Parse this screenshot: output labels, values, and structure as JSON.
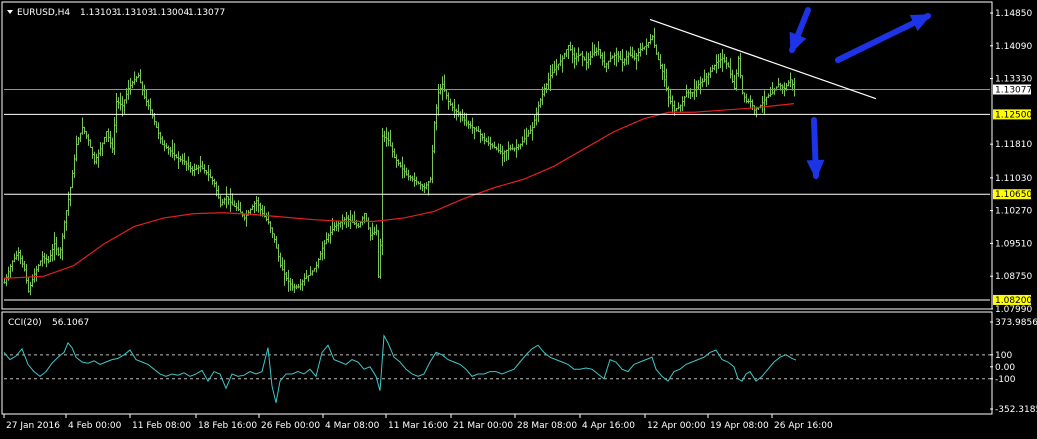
{
  "colors": {
    "background": "#000000",
    "frame": "#ffffff",
    "candles": "#7bc35a",
    "moving_average": "#e02020",
    "cci_line": "#3fc7c7",
    "trendline": "#ffffff",
    "level_line": "#ffffff",
    "level_tag_bg": "#ffff00",
    "current_price_line": "#8a93a8",
    "arrows": "#1c34e6"
  },
  "chart_data": [
    {
      "type": "candlestick",
      "header": {
        "symbol": "EURUSD,H4",
        "open": "1.13103",
        "high": "1.13103",
        "low": "1.13004",
        "close": "1.13077"
      },
      "ylim": [
        1.0799,
        1.1485
      ],
      "y_ticks": [
        "1.14850",
        "1.14090",
        "1.13330",
        "1.12500",
        "1.11810",
        "1.11030",
        "1.10270",
        "1.09510",
        "1.08750",
        "1.07990"
      ],
      "x_ticks": [
        "27 Jan 2016",
        "4 Feb 00:00",
        "11 Feb 08:00",
        "18 Feb 16:00",
        "26 Feb 00:00",
        "4 Mar 08:00",
        "11 Mar 16:00",
        "21 Mar 00:00",
        "28 Mar 08:00",
        "4 Apr 16:00",
        "12 Apr 00:00",
        "19 Apr 08:00",
        "26 Apr 16:00"
      ],
      "current_price": "1.13077",
      "horizontal_levels": [
        {
          "price": 1.125,
          "label": "1.12500"
        },
        {
          "price": 1.1065,
          "label": "1.10650"
        },
        {
          "price": 1.082,
          "label": "1.08200"
        }
      ],
      "close_path": [
        [
          0,
          1.086
        ],
        [
          8,
          1.091
        ],
        [
          14,
          1.093
        ],
        [
          20,
          1.089
        ],
        [
          24,
          1.084
        ],
        [
          30,
          1.088
        ],
        [
          38,
          1.092
        ],
        [
          44,
          1.091
        ],
        [
          50,
          1.095
        ],
        [
          55,
          1.092
        ],
        [
          60,
          1.1
        ],
        [
          66,
          1.108
        ],
        [
          72,
          1.118
        ],
        [
          78,
          1.122
        ],
        [
          84,
          1.119
        ],
        [
          90,
          1.114
        ],
        [
          96,
          1.117
        ],
        [
          102,
          1.121
        ],
        [
          108,
          1.117
        ],
        [
          112,
          1.128
        ],
        [
          118,
          1.127
        ],
        [
          124,
          1.131
        ],
        [
          130,
          1.133
        ],
        [
          134,
          1.134
        ],
        [
          140,
          1.129
        ],
        [
          146,
          1.126
        ],
        [
          152,
          1.122
        ],
        [
          158,
          1.118
        ],
        [
          164,
          1.117
        ],
        [
          172,
          1.115
        ],
        [
          180,
          1.114
        ],
        [
          188,
          1.112
        ],
        [
          196,
          1.113
        ],
        [
          204,
          1.111
        ],
        [
          210,
          1.109
        ],
        [
          216,
          1.104
        ],
        [
          222,
          1.106
        ],
        [
          228,
          1.104
        ],
        [
          234,
          1.103
        ],
        [
          240,
          1.101
        ],
        [
          246,
          1.103
        ],
        [
          252,
          1.105
        ],
        [
          258,
          1.102
        ],
        [
          264,
          1.1
        ],
        [
          270,
          1.096
        ],
        [
          276,
          1.09
        ],
        [
          282,
          1.087
        ],
        [
          288,
          1.085
        ],
        [
          294,
          1.085
        ],
        [
          300,
          1.087
        ],
        [
          306,
          1.088
        ],
        [
          312,
          1.09
        ],
        [
          318,
          1.094
        ],
        [
          324,
          1.097
        ],
        [
          330,
          1.099
        ],
        [
          336,
          1.1
        ],
        [
          342,
          1.101
        ],
        [
          348,
          1.1
        ],
        [
          354,
          1.099
        ],
        [
          360,
          1.102
        ],
        [
          366,
          1.097
        ],
        [
          372,
          1.098
        ],
        [
          375,
          1.082
        ],
        [
          378,
          1.12
        ],
        [
          384,
          1.119
        ],
        [
          390,
          1.115
        ],
        [
          396,
          1.113
        ],
        [
          402,
          1.111
        ],
        [
          408,
          1.11
        ],
        [
          414,
          1.109
        ],
        [
          420,
          1.108
        ],
        [
          426,
          1.11
        ],
        [
          430,
          1.123
        ],
        [
          434,
          1.13
        ],
        [
          438,
          1.132
        ],
        [
          444,
          1.128
        ],
        [
          450,
          1.126
        ],
        [
          456,
          1.125
        ],
        [
          462,
          1.123
        ],
        [
          468,
          1.122
        ],
        [
          474,
          1.121
        ],
        [
          480,
          1.119
        ],
        [
          486,
          1.118
        ],
        [
          492,
          1.117
        ],
        [
          498,
          1.116
        ],
        [
          504,
          1.117
        ],
        [
          510,
          1.117
        ],
        [
          516,
          1.118
        ],
        [
          522,
          1.12
        ],
        [
          528,
          1.122
        ],
        [
          534,
          1.127
        ],
        [
          540,
          1.131
        ],
        [
          546,
          1.134
        ],
        [
          552,
          1.136
        ],
        [
          558,
          1.138
        ],
        [
          564,
          1.141
        ],
        [
          570,
          1.138
        ],
        [
          576,
          1.139
        ],
        [
          582,
          1.137
        ],
        [
          588,
          1.139
        ],
        [
          594,
          1.14
        ],
        [
          600,
          1.136
        ],
        [
          606,
          1.138
        ],
        [
          612,
          1.139
        ],
        [
          618,
          1.137
        ],
        [
          624,
          1.139
        ],
        [
          630,
          1.138
        ],
        [
          636,
          1.14
        ],
        [
          642,
          1.141
        ],
        [
          648,
          1.143
        ],
        [
          652,
          1.139
        ],
        [
          658,
          1.135
        ],
        [
          664,
          1.129
        ],
        [
          670,
          1.126
        ],
        [
          676,
          1.127
        ],
        [
          682,
          1.13
        ],
        [
          688,
          1.13
        ],
        [
          694,
          1.132
        ],
        [
          700,
          1.133
        ],
        [
          706,
          1.135
        ],
        [
          712,
          1.137
        ],
        [
          718,
          1.138
        ],
        [
          724,
          1.136
        ],
        [
          730,
          1.131
        ],
        [
          734,
          1.138
        ],
        [
          738,
          1.13
        ],
        [
          742,
          1.128
        ],
        [
          746,
          1.128
        ],
        [
          750,
          1.126
        ],
        [
          756,
          1.127
        ],
        [
          762,
          1.129
        ],
        [
          768,
          1.13
        ],
        [
          774,
          1.132
        ],
        [
          780,
          1.131
        ],
        [
          786,
          1.133
        ],
        [
          790,
          1.1308
        ]
      ],
      "moving_average": [
        [
          0,
          1.087
        ],
        [
          40,
          1.0875
        ],
        [
          70,
          1.09
        ],
        [
          100,
          1.095
        ],
        [
          130,
          1.099
        ],
        [
          160,
          1.101
        ],
        [
          190,
          1.102
        ],
        [
          220,
          1.1022
        ],
        [
          250,
          1.1018
        ],
        [
          280,
          1.1012
        ],
        [
          310,
          1.1006
        ],
        [
          340,
          1.1002
        ],
        [
          370,
          1.1002
        ],
        [
          400,
          1.101
        ],
        [
          430,
          1.1025
        ],
        [
          460,
          1.1055
        ],
        [
          490,
          1.108
        ],
        [
          520,
          1.11
        ],
        [
          550,
          1.113
        ],
        [
          580,
          1.117
        ],
        [
          610,
          1.121
        ],
        [
          640,
          1.124
        ],
        [
          665,
          1.1255
        ],
        [
          690,
          1.1255
        ],
        [
          720,
          1.126
        ],
        [
          750,
          1.1265
        ],
        [
          770,
          1.127
        ],
        [
          790,
          1.1275
        ]
      ],
      "trendline": [
        {
          "date_at": 0,
          "price": 1.147
        },
        {
          "date_at": 1,
          "price": 1.1305
        }
      ]
    },
    {
      "type": "line",
      "indicator": "CCI(20)",
      "current_value": "56.1067",
      "max_label": "373.9856",
      "min_label": "-352.3185",
      "ylim": [
        -352.3185,
        373.9856
      ],
      "y_ticks": [
        "100",
        "0.00",
        "-100"
      ],
      "levels": [
        100,
        -100
      ],
      "values": [
        [
          0,
          120
        ],
        [
          6,
          60
        ],
        [
          12,
          90
        ],
        [
          18,
          150
        ],
        [
          24,
          20
        ],
        [
          30,
          -40
        ],
        [
          36,
          -80
        ],
        [
          42,
          -40
        ],
        [
          48,
          30
        ],
        [
          54,
          80
        ],
        [
          60,
          120
        ],
        [
          64,
          200
        ],
        [
          68,
          160
        ],
        [
          72,
          80
        ],
        [
          78,
          40
        ],
        [
          84,
          30
        ],
        [
          90,
          50
        ],
        [
          96,
          20
        ],
        [
          102,
          40
        ],
        [
          108,
          60
        ],
        [
          114,
          70
        ],
        [
          120,
          100
        ],
        [
          126,
          140
        ],
        [
          132,
          60
        ],
        [
          138,
          40
        ],
        [
          144,
          20
        ],
        [
          150,
          -20
        ],
        [
          156,
          -60
        ],
        [
          162,
          -80
        ],
        [
          168,
          -60
        ],
        [
          174,
          -70
        ],
        [
          180,
          -50
        ],
        [
          186,
          -80
        ],
        [
          192,
          -60
        ],
        [
          198,
          -30
        ],
        [
          204,
          -120
        ],
        [
          210,
          -40
        ],
        [
          216,
          -60
        ],
        [
          222,
          -180
        ],
        [
          228,
          -60
        ],
        [
          234,
          -80
        ],
        [
          240,
          -70
        ],
        [
          246,
          -40
        ],
        [
          252,
          -60
        ],
        [
          258,
          -40
        ],
        [
          264,
          160
        ],
        [
          268,
          -160
        ],
        [
          272,
          -300
        ],
        [
          276,
          -120
        ],
        [
          282,
          -60
        ],
        [
          288,
          -60
        ],
        [
          294,
          -40
        ],
        [
          300,
          -60
        ],
        [
          306,
          -20
        ],
        [
          312,
          -80
        ],
        [
          318,
          120
        ],
        [
          324,
          180
        ],
        [
          330,
          60
        ],
        [
          336,
          40
        ],
        [
          342,
          20
        ],
        [
          348,
          60
        ],
        [
          354,
          40
        ],
        [
          360,
          -20
        ],
        [
          366,
          0
        ],
        [
          372,
          -80
        ],
        [
          376,
          -200
        ],
        [
          380,
          260
        ],
        [
          384,
          200
        ],
        [
          390,
          80
        ],
        [
          396,
          40
        ],
        [
          402,
          -20
        ],
        [
          408,
          -60
        ],
        [
          414,
          -80
        ],
        [
          420,
          -60
        ],
        [
          426,
          40
        ],
        [
          432,
          120
        ],
        [
          438,
          100
        ],
        [
          444,
          60
        ],
        [
          450,
          40
        ],
        [
          456,
          20
        ],
        [
          462,
          -20
        ],
        [
          468,
          -80
        ],
        [
          474,
          -60
        ],
        [
          480,
          -60
        ],
        [
          486,
          -40
        ],
        [
          492,
          -40
        ],
        [
          498,
          -60
        ],
        [
          504,
          -40
        ],
        [
          510,
          -20
        ],
        [
          516,
          40
        ],
        [
          522,
          100
        ],
        [
          528,
          150
        ],
        [
          534,
          180
        ],
        [
          540,
          120
        ],
        [
          546,
          80
        ],
        [
          552,
          60
        ],
        [
          558,
          40
        ],
        [
          564,
          20
        ],
        [
          570,
          -20
        ],
        [
          576,
          -20
        ],
        [
          582,
          -10
        ],
        [
          588,
          -20
        ],
        [
          594,
          -60
        ],
        [
          600,
          -100
        ],
        [
          606,
          60
        ],
        [
          612,
          40
        ],
        [
          618,
          -20
        ],
        [
          624,
          -40
        ],
        [
          630,
          20
        ],
        [
          636,
          40
        ],
        [
          642,
          60
        ],
        [
          648,
          80
        ],
        [
          652,
          -20
        ],
        [
          658,
          -80
        ],
        [
          664,
          -120
        ],
        [
          670,
          -40
        ],
        [
          676,
          -20
        ],
        [
          682,
          20
        ],
        [
          688,
          40
        ],
        [
          694,
          60
        ],
        [
          700,
          80
        ],
        [
          706,
          120
        ],
        [
          712,
          140
        ],
        [
          718,
          60
        ],
        [
          724,
          40
        ],
        [
          730,
          0
        ],
        [
          734,
          -100
        ],
        [
          738,
          -120
        ],
        [
          742,
          -60
        ],
        [
          746,
          -40
        ],
        [
          752,
          -120
        ],
        [
          758,
          -80
        ],
        [
          764,
          -20
        ],
        [
          770,
          40
        ],
        [
          776,
          80
        ],
        [
          782,
          100
        ],
        [
          788,
          70
        ],
        [
          792,
          56
        ]
      ]
    }
  ]
}
